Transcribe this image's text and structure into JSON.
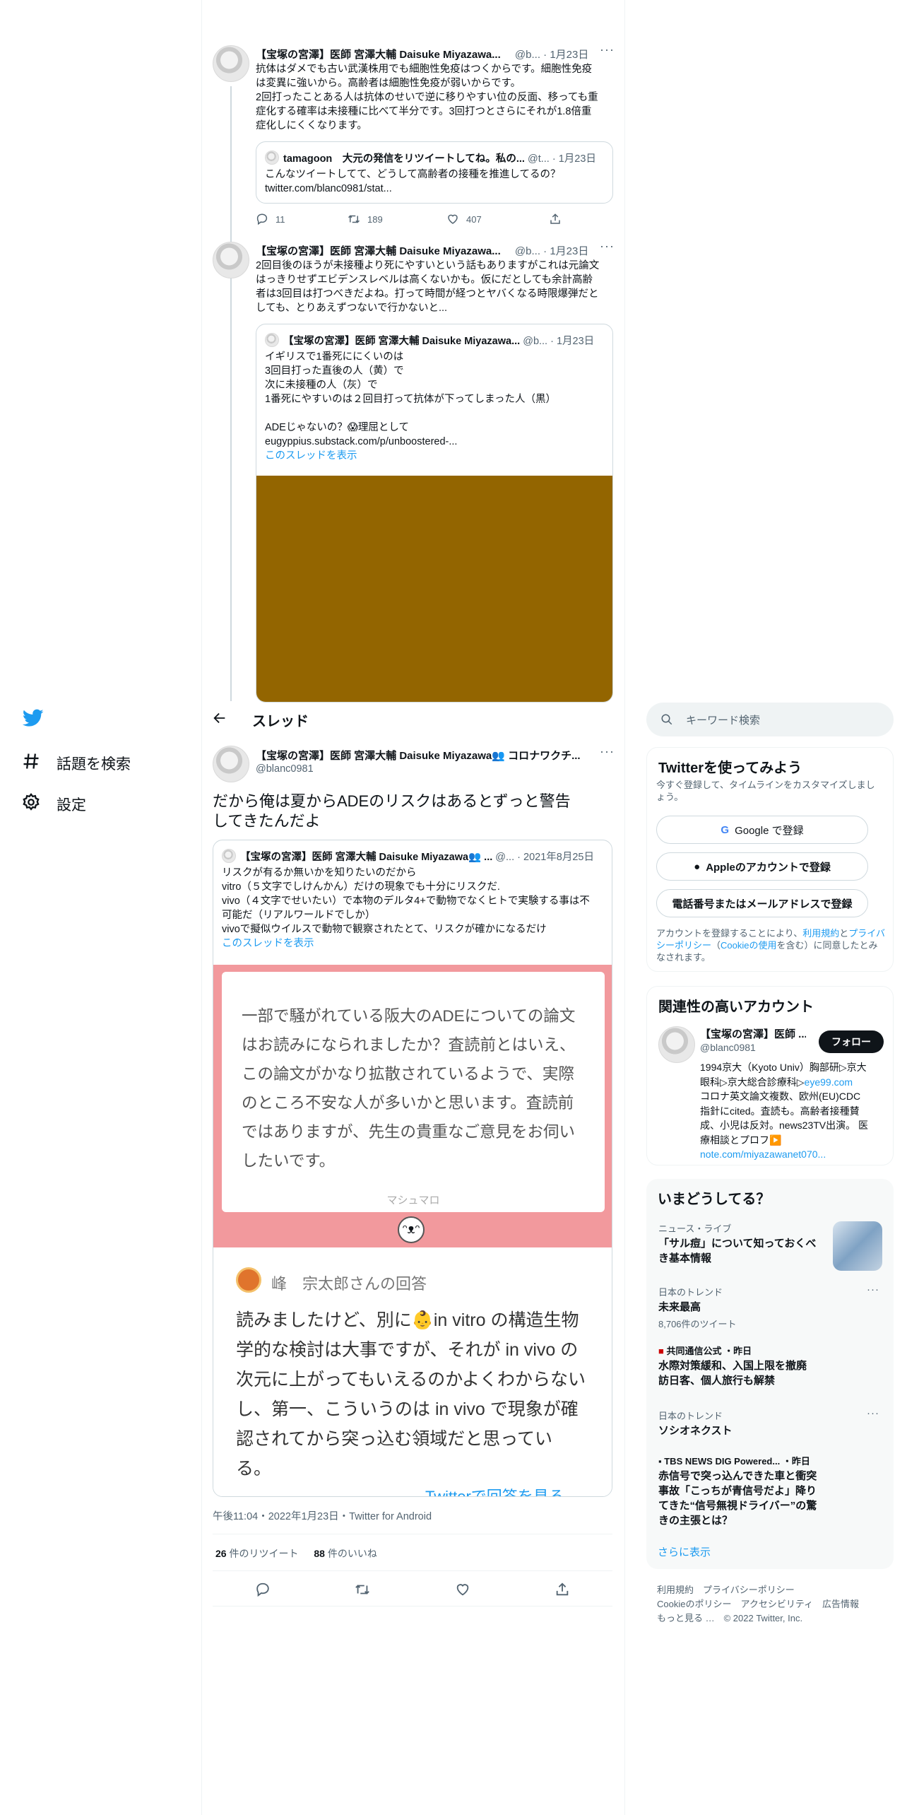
{
  "nav": {
    "explore_label": "話題を検索",
    "settings_label": "設定"
  },
  "thread_header": {
    "title": "スレッド"
  },
  "tweet1": {
    "author": "【宝塚の宮澤】医師 宮澤大輔 Daisuke Miyazawa...",
    "handle": "@b...",
    "date": "1月23日",
    "lines": [
      "抗体はダメでも古い武漢株用でも細胞性免疫はつくからです。細胞性免疫",
      "は変異に強いから。高齢者は細胞性免疫が弱いからです。",
      "2回打ったことある人は抗体のせいで逆に移りやすい位の反面、移っても重",
      "症化する確率は未接種に比べて半分です。3回打つとさらにそれが1.8倍重",
      "症化しにくくなります。"
    ],
    "quote": {
      "author": "tamagoon　大元の発信をリツイートしてね。私の...",
      "handle": "@t...",
      "date": "1月23日",
      "line1": "こんなツイートしてて、どうして高齢者の接種を推進してるの？",
      "line2": "twitter.com/blanc0981/stat..."
    },
    "replies": "11",
    "retweets": "189",
    "likes": "407"
  },
  "tweet2": {
    "author": "【宝塚の宮澤】医師 宮澤大輔 Daisuke Miyazawa...",
    "handle": "@b...",
    "date": "1月23日",
    "lines": [
      "2回目後のほうが未接種より死にやすいという話もありますがこれは元論文",
      "はっきりせずエビデンスレベルは高くないかも。仮にだとしても余計高齢",
      "者は3回目は打つべきだよね。打って時間が経つとヤバくなる時限爆弾だと",
      "しても、とりあえずつないで行かないと..."
    ],
    "quote": {
      "author": "【宝塚の宮澤】医師 宮澤大輔 Daisuke Miyazawa...",
      "handle": "@b...",
      "date": "1月23日",
      "lines": [
        "イギリスで1番死ににくいのは",
        "3回目打った直後の人（黄）で",
        "次に未接種の人（灰）で",
        "1番死にやすいのは２回目打って抗体が下ってしまった人（黒）",
        "",
        "ADEじゃないの？😱理屈として",
        "eugyppius.substack.com/p/unboostered-..."
      ],
      "show_thread": "このスレッドを表示",
      "image_color": "#936500"
    }
  },
  "main_tweet": {
    "author": "【宝塚の宮澤】医師 宮澤大輔 Daisuke Miyazawa👥 コロナワクチ...",
    "handle": "@blanc0981",
    "text_line1": "だから俺は夏からADEのリスクはあるとずっと警告",
    "text_line2": "してきたんだよ",
    "quote": {
      "author": "【宝塚の宮澤】医師 宮澤大輔 Daisuke Miyazawa👥 ...",
      "handle": "@...",
      "date": "2021年8月25日",
      "lines": [
        "リスクが有るか無いかを知りたいのだから",
        "vitro（５文字でしけんかん）だけの現象でも十分にリスクだ.",
        "vivo（４文字でせいたい）で本物のデルタ4+で動物でなくヒトで実験する事は不",
        "可能だ（リアルワールドでしか）",
        "vivoで擬似ウイルスで動物で観察されたとて、リスクが確かになるだけ"
      ],
      "show_thread": "このスレッドを表示",
      "marshmallow": {
        "question_lines": [
          "一部で騒がれている阪大のADEについての論文",
          "はお読みになられましたか？査読前とはいえ、",
          "この論文がかなり拡散されているようで、実際",
          "のところ不安な人が多いかと思います。査読前",
          "ではありますが、先生の貴重なご意見をお伺い",
          "したいです。"
        ],
        "brand": "マシュマロ",
        "answer_by": "峰　宗太郎さんの回答",
        "answer_lines": [
          "読みましたけど、別に👶in vitro の構造生物",
          "学的な検討は大事ですが、それが in vivo の",
          "次元に上がってもいえるのかよくわからない",
          "し、第一、こういうのは in vivo で現象が確",
          "認されてから突っ込む領域だと思ってい",
          "る。"
        ],
        "more_link": "Twitterで回答を見る"
      }
    },
    "timestamp": "午後11:04・2022年1月23日・Twitter for Android",
    "retweet_count": "26",
    "retweet_label": " 件のリツイート",
    "like_count": "88",
    "like_label": " 件のいいね"
  },
  "search": {
    "placeholder": "キーワード検索"
  },
  "signup": {
    "title": "Twitterを使ってみよう",
    "desc_line1": "今すぐ登録して、タイムラインをカスタマイズしまし",
    "desc_line2": "ょう。",
    "google": "Google で登録",
    "apple": "Appleのアカウントで登録",
    "phone": "電話番号またはメールアドレスで登録",
    "legal_pre": "アカウントを登録することにより、",
    "terms": "利用規約",
    "and": "と",
    "privacy": "プライバシーポリシー",
    "cookie_pre": "（",
    "cookie": "Cookieの使用",
    "legal_post": "を含む）に同意したとみなされます。"
  },
  "related": {
    "title": "関連性の高いアカウント",
    "name": "【宝塚の宮澤】医師 ...",
    "handle": "@blanc0981",
    "follow": "フォロー",
    "bio_lines": [
      "1994京大（Kyoto Univ）胸部研▷京大",
      "眼科▷京大総合診療科▷"
    ],
    "bio_link": "eye99.com",
    "bio_lines2": [
      "コロナ英文論文複数、欧州(EU)CDC",
      "指針にcited。査読も。高齢者接種賛",
      "成、小児は反対。news23TV出演。 医",
      "療相談とプロフ▶️"
    ],
    "bio_link2": "note.com/miyazawanet070..."
  },
  "trends": {
    "title": "いまどうしてる？",
    "items": [
      {
        "cat": "ニュース・ライブ",
        "title1": "「サル痘」について知っておくべ",
        "title2": "き基本情報",
        "sub": ""
      },
      {
        "cat": "日本のトレンド",
        "title1": "未来最高",
        "title2": "",
        "sub": "8,706件のツイート"
      },
      {
        "cat": "共同通信公式 ・昨日",
        "title1": "水際対策緩和、入国上限を撤廃",
        "title2": "訪日客、個人旅行も解禁",
        "sub": ""
      },
      {
        "cat": "日本のトレンド",
        "title1": "ソシオネクスト",
        "title2": "",
        "sub": ""
      },
      {
        "cat": "TBS NEWS DIG Powered... ・昨日",
        "title1": "赤信号で突っ込んできた車と衝突",
        "title2": "事故「こっちが青信号だよ」降り",
        "title3": "てきた“信号無視ドライバー”の驚",
        "title4": "きの主張とは？",
        "sub": ""
      }
    ],
    "show_more": "さらに表示"
  },
  "footer": {
    "line1": "利用規約　プライバシーポリシー",
    "line2": "Cookieのポリシー　アクセシビリティ　広告情報",
    "line3": "もっと見る …　© 2022 Twitter, Inc."
  }
}
